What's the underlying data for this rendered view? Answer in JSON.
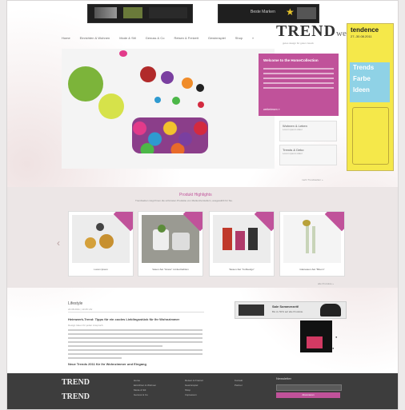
{
  "header": {
    "nav": [
      "Home",
      "Einrichten & Wohnen",
      "Mode & Stil",
      "Genuss & Co",
      "Reisen & Freizeit",
      "Gewinnspiel",
      "Shop",
      "»"
    ],
    "logo_main": "TREND",
    "logo_sub": "welten",
    "logo_tagline": "gutes design für guten zweck"
  },
  "ad": {
    "brand": "tendence",
    "brand_sub": "27.-30.08.2011",
    "blue_text": [
      "Trends",
      "Farbe",
      "Ideen"
    ]
  },
  "banners": {
    "left_text": "",
    "right_text": "Beste Marken"
  },
  "hero": {
    "feature_title": "Welcome to the HomeCollection",
    "feature_more": "weiterlesen »",
    "box1_title": "Wohnen & Leben",
    "box1_sub": "Lorem ipsum dolor",
    "box2_title": "Trends & Deko",
    "box2_sub": "Lorem ipsum dolor",
    "link": "mehr Trendwelten »"
  },
  "products": {
    "title": "Produkt Highlights",
    "subtitle": "Trendwelten zeigt Ihnen die schönsten Produkte von Markenherstellern, ausgewählt für Sie.",
    "items": [
      {
        "caption": "Lorem Ipsum"
      },
      {
        "caption": "Vasen-Set \"Grace\" Limited Edition"
      },
      {
        "caption": "Tassen-Set \"Coffee2go\""
      },
      {
        "caption": "Glasvasen-Set \"Bloom\""
      }
    ],
    "more": "alle Produkte »"
  },
  "article": {
    "title": "Lifestyle",
    "date": "24.08.2011 | 10:45 Uhr",
    "heading": "Heimwerk-Trend: Tipps für ein cooles Lieblingsstück für Ihr Wohnzimmer",
    "subheading": "Design Ideen für jeden Anspruch",
    "heading2": "Neue Trends 2011 für Ihr Wohnzimmer und Eingang"
  },
  "promo": {
    "title": "Sale Sommerzeit!",
    "sub": "Bis zu 50% auf alle Produkte"
  },
  "footer": {
    "logo1": "TREND",
    "logo2": "TREND",
    "col1": [
      "Home",
      "Einrichten & Wohnen",
      "Mode & Stil",
      "Genuss & Co"
    ],
    "col2": [
      "Reisen & Freizeit",
      "Gewinnspiel",
      "Shop",
      "Impressum"
    ],
    "col3": [
      "Kontakt",
      "Partner"
    ],
    "newsletter_label": "Newsletter",
    "newsletter_button": "Abonnieren"
  },
  "colors": {
    "accent": "#c0529a",
    "ad_yellow": "#f5e84a",
    "footer": "#3d3d3d"
  }
}
